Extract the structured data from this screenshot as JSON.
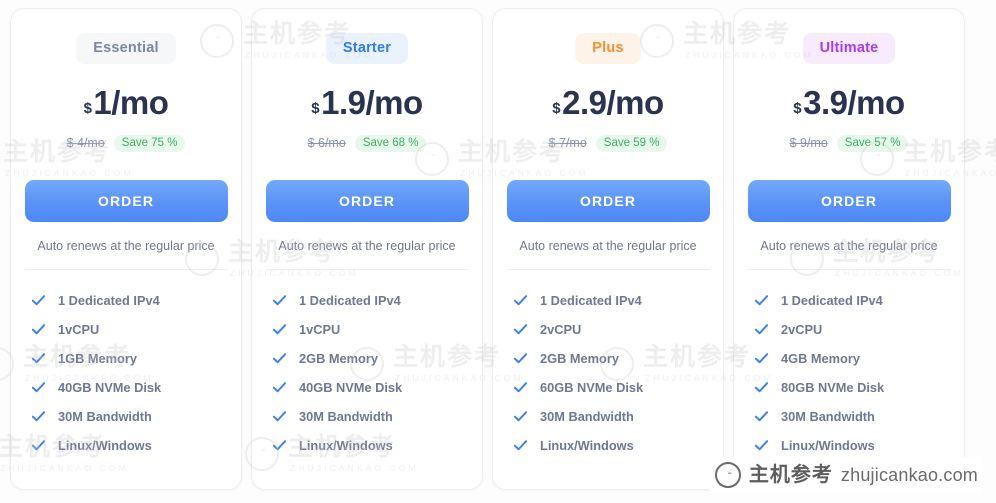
{
  "watermark": {
    "logo_icon": "lightning-circle-icon",
    "cn_text": "主机参考",
    "en_text": "ZHUJICANKAO.COM",
    "footer_cn_text": "主机参考",
    "footer_domain": "zhujicankao.com"
  },
  "colors": {
    "price_text": "#2b3350",
    "button_blue": "#5b93f7",
    "save_green": "#3fae63",
    "badge_essential": "#7b87a5",
    "badge_starter": "#2f7bf6",
    "badge_plus": "#f59031",
    "badge_ultimate": "#a43cf0",
    "check_blue": "#3d7ff0"
  },
  "common": {
    "order_label": "ORDER",
    "renew_note": "Auto renews at the regular price",
    "currency_symbol": "$",
    "check_icon": "check-icon"
  },
  "plans": [
    {
      "name": "Essential",
      "badge_style": "essential",
      "price": "1/mo",
      "old_price": "$ 4/mo",
      "save": "Save 75 %",
      "features": [
        "1 Dedicated IPv4",
        "1vCPU",
        "1GB Memory",
        "40GB NVMe Disk",
        "30M Bandwidth",
        "Linux/Windows"
      ]
    },
    {
      "name": "Starter",
      "badge_style": "starter",
      "price": "1.9/mo",
      "old_price": "$ 6/mo",
      "save": "Save 68 %",
      "features": [
        "1 Dedicated IPv4",
        "1vCPU",
        "2GB Memory",
        "40GB NVMe Disk",
        "30M Bandwidth",
        "Linux/Windows"
      ]
    },
    {
      "name": "Plus",
      "badge_style": "plus",
      "price": "2.9/mo",
      "old_price": "$ 7/mo",
      "save": "Save 59 %",
      "features": [
        "1 Dedicated IPv4",
        "2vCPU",
        "2GB Memory",
        "60GB NVMe Disk",
        "30M Bandwidth",
        "Linux/Windows"
      ]
    },
    {
      "name": "Ultimate",
      "badge_style": "ultimate",
      "price": "3.9/mo",
      "old_price": "$ 9/mo",
      "save": "Save 57 %",
      "features": [
        "1 Dedicated IPv4",
        "2vCPU",
        "4GB Memory",
        "80GB NVMe Disk",
        "30M Bandwidth",
        "Linux/Windows"
      ]
    }
  ]
}
